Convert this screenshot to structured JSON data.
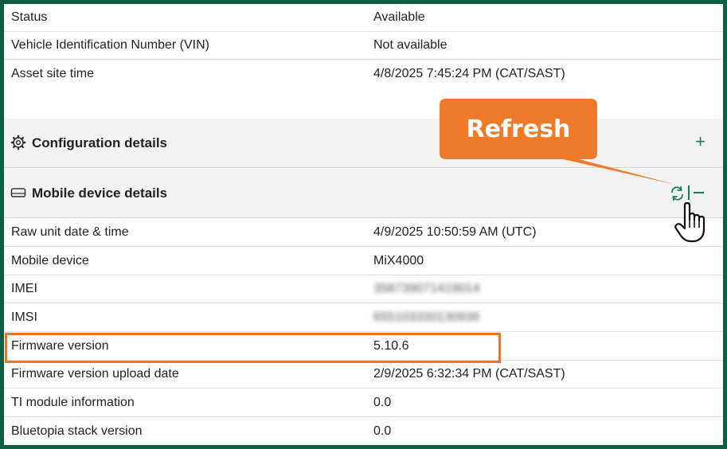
{
  "asset_rows": [
    {
      "label": "Status",
      "value": "Available"
    },
    {
      "label": "Vehicle Identification Number (VIN)",
      "value": "Not available"
    },
    {
      "label": "Asset site time",
      "value": "4/8/2025 7:45:24 PM (CAT/SAST)"
    }
  ],
  "configuration_section": {
    "title": "Configuration details",
    "icon": "gear-icon",
    "expand_icon": "plus-icon"
  },
  "mobile_section": {
    "title": "Mobile device details",
    "icon": "device-icon",
    "refresh_icon": "refresh-icon",
    "collapse_icon": "minus-icon"
  },
  "mobile_rows": [
    {
      "label": "Raw unit date & time",
      "value": "4/9/2025 10:50:59 AM (UTC)"
    },
    {
      "label": "Mobile device",
      "value": "MiX4000"
    },
    {
      "label": "IMEI",
      "value": "358739071419014"
    },
    {
      "label": "IMSI",
      "value": "655103330130936"
    },
    {
      "label": "Firmware version",
      "value": "5.10.6"
    },
    {
      "label": "Firmware version upload date",
      "value": "2/9/2025 6:32:34 PM (CAT/SAST)"
    },
    {
      "label": "TI module information",
      "value": "0.0"
    },
    {
      "label": "Bluetopia stack version",
      "value": "0.0"
    }
  ],
  "callout": {
    "text": "Refresh"
  },
  "colors": {
    "frame": "#0e5e44",
    "accent": "#1a7a58",
    "callout": "#ef7b2a",
    "highlight": "#e8762a"
  }
}
